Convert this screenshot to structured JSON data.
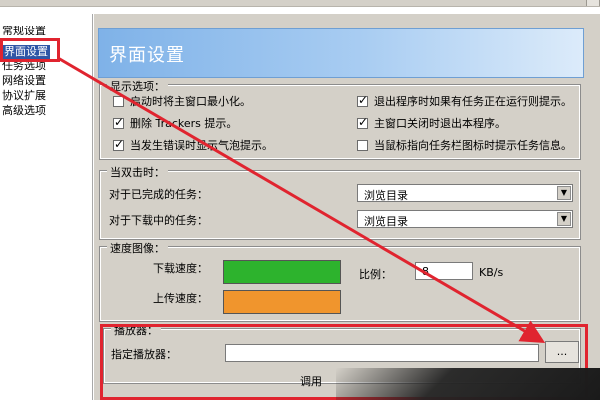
{
  "nav": {
    "items": [
      {
        "label": "常规设置",
        "selected": false
      },
      {
        "label": "界面设置",
        "selected": true
      },
      {
        "label": "任务选项",
        "selected": false
      },
      {
        "label": "网络设置",
        "selected": false
      },
      {
        "label": "协议扩展",
        "selected": false
      },
      {
        "label": "高级选项",
        "selected": false
      }
    ]
  },
  "header": {
    "title": "界面设置"
  },
  "display_options": {
    "label": "显示选项：",
    "items": [
      {
        "label": "启动时将主窗口最小化。",
        "checked": false
      },
      {
        "label": "退出程序时如果有任务正在运行则提示。",
        "checked": true
      },
      {
        "label": "删除 Trackers 提示。",
        "checked": true
      },
      {
        "label": "主窗口关闭时退出本程序。",
        "checked": true
      },
      {
        "label": "当发生错误时显示气泡提示。",
        "checked": true
      },
      {
        "label": "当鼠标指向任务栏图标时提示任务信息。",
        "checked": false
      }
    ]
  },
  "double_click": {
    "label": "当双击时：",
    "rows": [
      {
        "label": "对于已完成的任务：",
        "value": "浏览目录"
      },
      {
        "label": "对于下载中的任务：",
        "value": "浏览目录"
      }
    ]
  },
  "speed_graph": {
    "label": "速度图像：",
    "download_label": "下载速度：",
    "upload_label": "上传速度：",
    "download_color": "#2db32d",
    "upload_color": "#f0952d",
    "ratio_label": "比例：",
    "ratio_value": "8",
    "ratio_unit": "KB/s"
  },
  "player": {
    "label": "播放器：",
    "field_label": "指定播放器：",
    "value": "",
    "browse_label": "...",
    "below_text": "调用"
  },
  "colors": {
    "accent": "#2f56a6",
    "annotation": "#e0242f"
  }
}
